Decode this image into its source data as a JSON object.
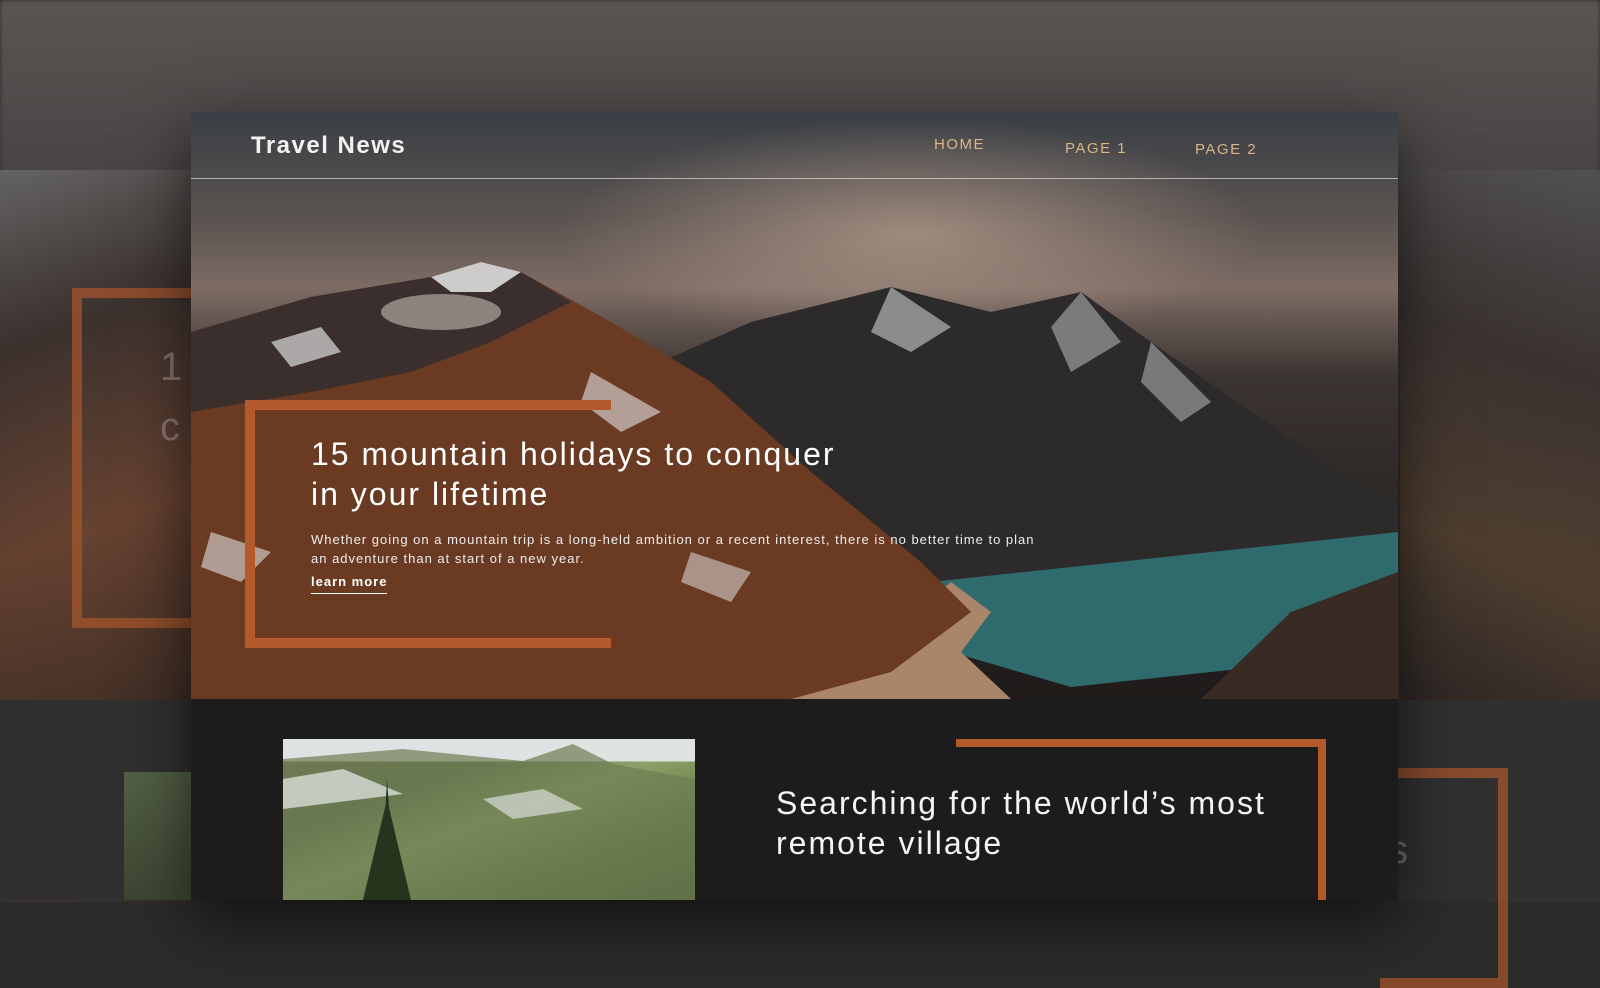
{
  "site": {
    "brand": "Travel News"
  },
  "nav": {
    "items": [
      {
        "label": "HOME"
      },
      {
        "label": "PAGE 1"
      },
      {
        "label": "PAGE 2"
      }
    ]
  },
  "hero": {
    "title": "15 mountain holidays to conquer in your lifetime",
    "excerpt": "Whether going on a mountain trip is a long-held ambition or a recent interest, there is no better time to plan an adventure than at start of a new year.",
    "cta_label": "learn more"
  },
  "featured_story": {
    "title": "Searching for the world’s most remote village"
  },
  "backdrop": {
    "partial_text_1": "1",
    "partial_text_2": "c",
    "partial_text_3": "’s"
  },
  "colors": {
    "accent": "#b25a2c",
    "nav_link": "#d9b58a",
    "dark_section": "#1d1c1c"
  }
}
